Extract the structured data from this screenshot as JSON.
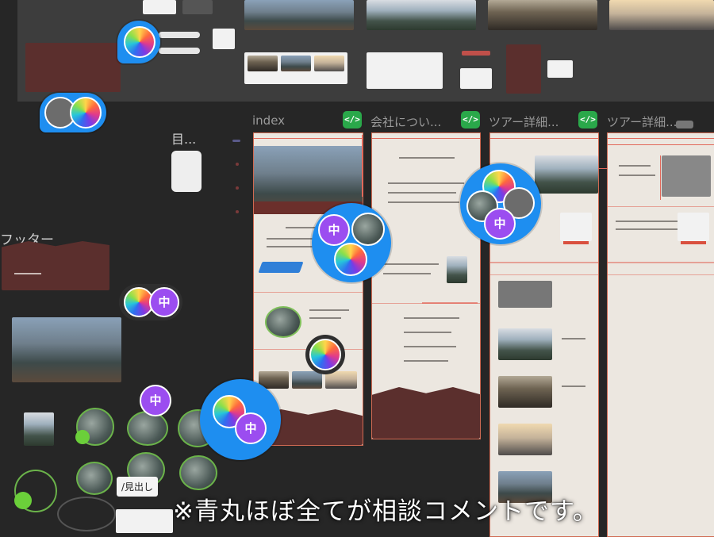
{
  "frames": [
    {
      "title": "index",
      "code_badge": "</>"
    },
    {
      "title": "会社につい...",
      "code_badge": "</>"
    },
    {
      "title": "ツアー詳細...",
      "code_badge": "</>"
    },
    {
      "title": "ツアー詳細...",
      "code_badge": ""
    }
  ],
  "left_labels": {
    "footer": "フッター",
    "partial": "目...",
    "heading_tag": "/見出し"
  },
  "avatars": {
    "naka": "中"
  },
  "caption": "※青丸ほぼ全てが相談コメントです。",
  "colors": {
    "canvas": "#262626",
    "comment_bubble": "#1e8ef0",
    "code_badge": "#2aa84a",
    "footer_brown": "#5b2f2d",
    "guide_red": "#e2685a"
  },
  "icons": {
    "code": "code-icon",
    "speaker": "speaker-icon",
    "color_avatar": "colorful-avatar-icon"
  }
}
